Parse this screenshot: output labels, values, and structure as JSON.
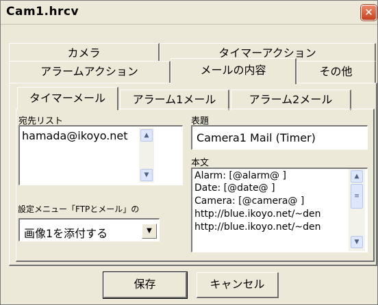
{
  "window": {
    "title": "Cam1.hrcv",
    "close_symbol": "✕"
  },
  "top_tabs": {
    "row1": [
      "カメラ",
      "タイマーアクション"
    ],
    "row2": [
      "アラームアクション",
      "メールの内容",
      "その他"
    ],
    "selected": "メールの内容"
  },
  "inner_tabs": {
    "labels": [
      "タイマーメール",
      "アラーム1メール",
      "アラーム2メール"
    ],
    "selected": "タイマーメール"
  },
  "recipients": {
    "label": "宛先リスト",
    "items": [
      "hamada@ikoyo.net"
    ]
  },
  "subject": {
    "label": "表題",
    "value": "Camera1 Mail (Timer)"
  },
  "body": {
    "label": "本文",
    "lines": [
      "Alarm:  [@alarm@ ]",
      "Date:   [@date@ ]",
      "Camera: [@camera@ ]",
      "http://blue.ikoyo.net/~den",
      "http://blue.ikoyo.net/~den"
    ]
  },
  "settings_menu": {
    "label": "設定メニュー「FTPとメール」の",
    "selected": "画像1を添付する"
  },
  "buttons": {
    "save": "保存",
    "cancel": "キャンセル"
  }
}
